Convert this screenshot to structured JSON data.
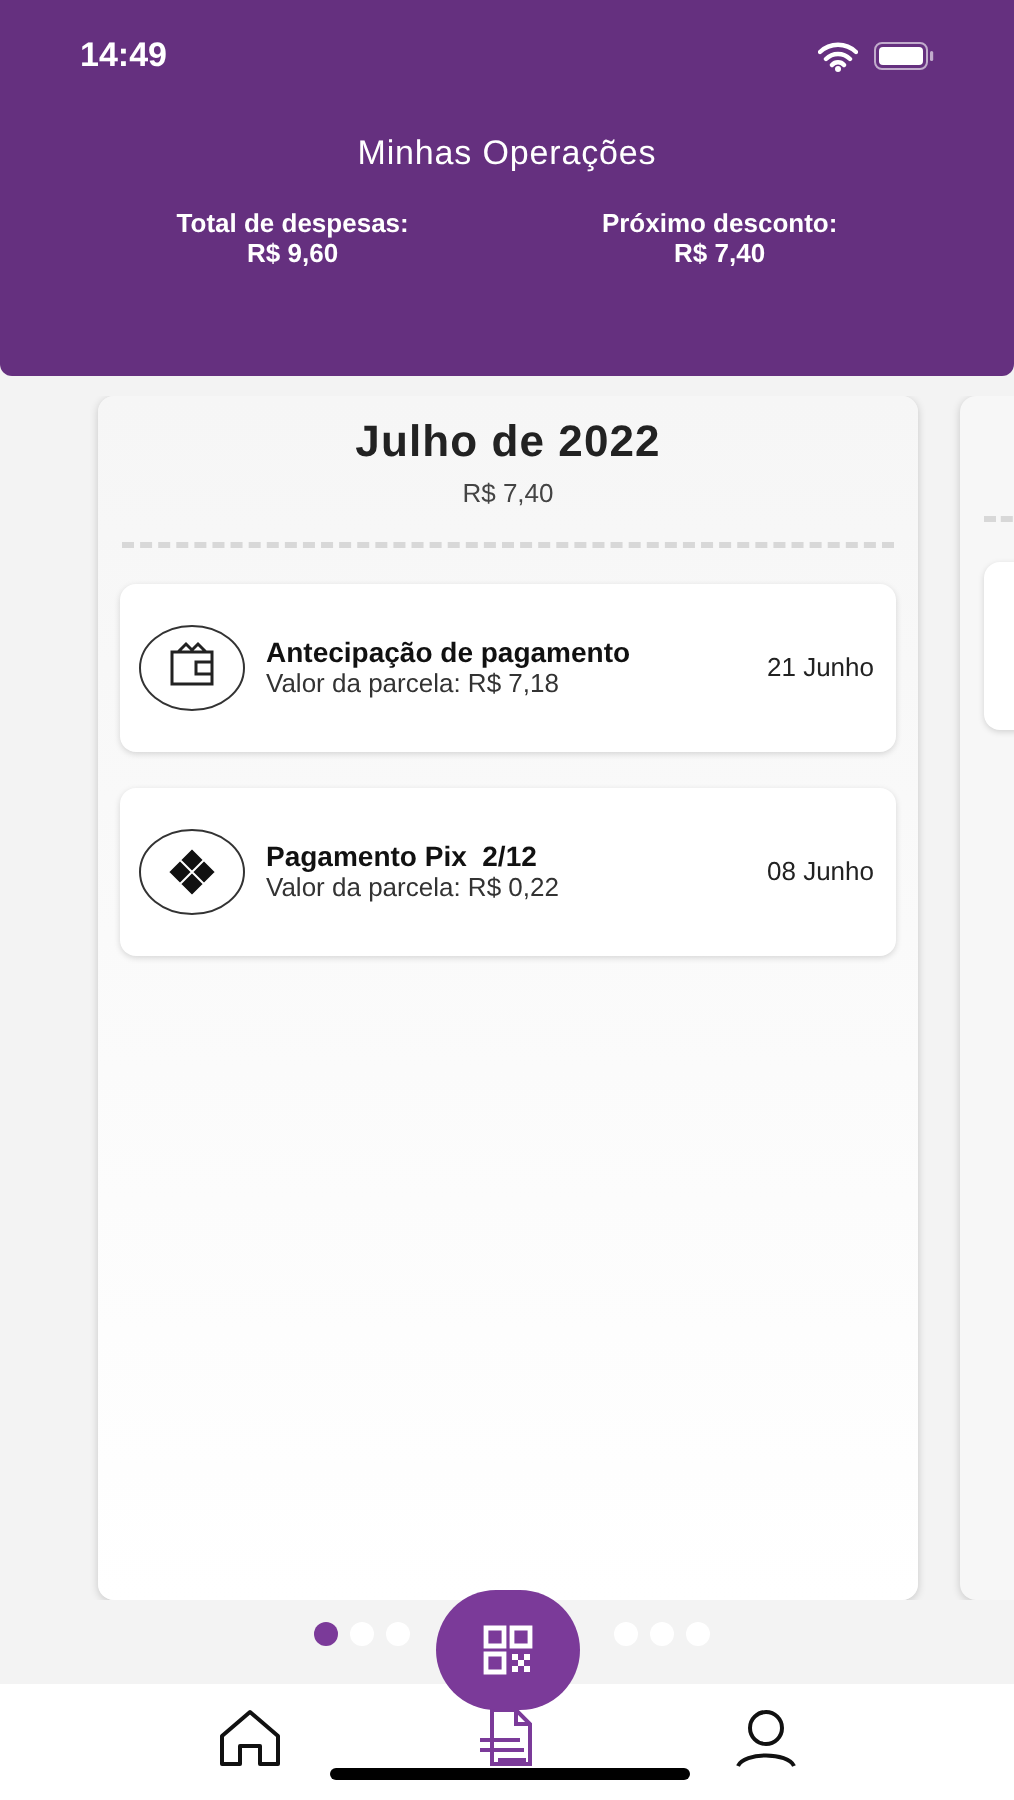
{
  "status_bar": {
    "time": "14:49"
  },
  "header": {
    "title": "Minhas Operações",
    "summary": [
      {
        "label": "Total de despesas:",
        "value": "R$ 9,60"
      },
      {
        "label": "Próximo desconto:",
        "value": "R$ 7,40"
      }
    ]
  },
  "month_card": {
    "title": "Julho de 2022",
    "total": "R$ 7,40",
    "operations": [
      {
        "kind": "wallet",
        "title": "Antecipação de pagamento",
        "detail": "Valor da parcela: R$ 7,18",
        "date": "21 Junho"
      },
      {
        "kind": "pix",
        "title": "Pagamento Pix  2/12",
        "detail": "Valor da parcela: R$ 0,22",
        "date": "08 Junho"
      }
    ]
  },
  "pager": [
    {
      "selected": true
    },
    {
      "selected": false
    },
    {
      "selected": false
    },
    {
      "selected": false
    },
    {
      "selected": false
    },
    {
      "selected": false
    }
  ],
  "bottom_nav": [
    {
      "kind": "home",
      "selected": false
    },
    {
      "kind": "operations",
      "selected": true
    },
    {
      "kind": "profile",
      "selected": false
    }
  ]
}
